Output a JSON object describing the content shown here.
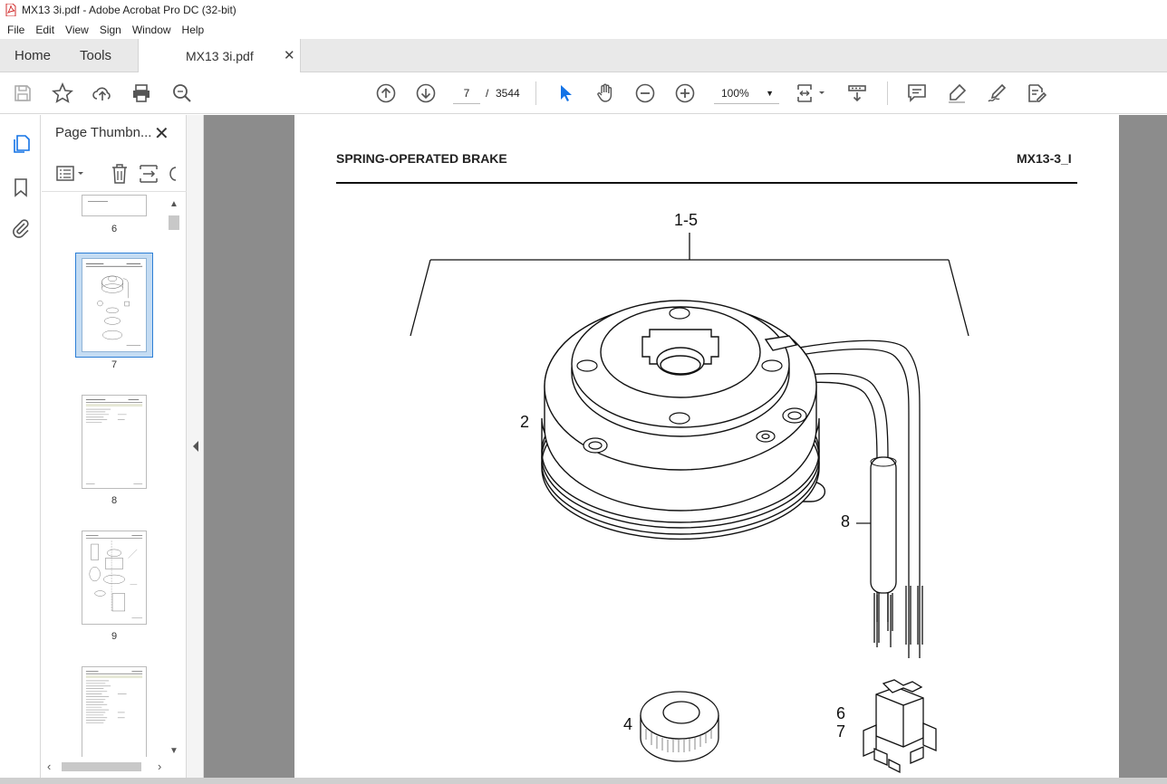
{
  "window": {
    "title": "MX13 3i.pdf - Adobe Acrobat Pro DC (32-bit)"
  },
  "menu": [
    "File",
    "Edit",
    "View",
    "Sign",
    "Window",
    "Help"
  ],
  "tabs": {
    "home": "Home",
    "tools": "Tools",
    "document": "MX13 3i.pdf"
  },
  "toolbar": {
    "current_page": "7",
    "separator": "/",
    "total_pages": "3544",
    "zoom": "100%"
  },
  "sidebar": {
    "title": "Page Thumbn...",
    "thumbnails": [
      {
        "label": "6"
      },
      {
        "label": "7",
        "selected": true
      },
      {
        "label": "8"
      },
      {
        "label": "9"
      },
      {
        "label": ""
      }
    ]
  },
  "document": {
    "header_left": "SPRING-OPERATED BRAKE",
    "header_right": "MX13-3_I",
    "callouts": {
      "group": "1-5",
      "body": "2",
      "cable": "8",
      "ring": "4",
      "connector_a": "6",
      "connector_b": "7"
    }
  },
  "colors": {
    "accent": "#1473e6",
    "selection": "#2d7fd6",
    "viewer_bg": "#8c8c8c"
  }
}
